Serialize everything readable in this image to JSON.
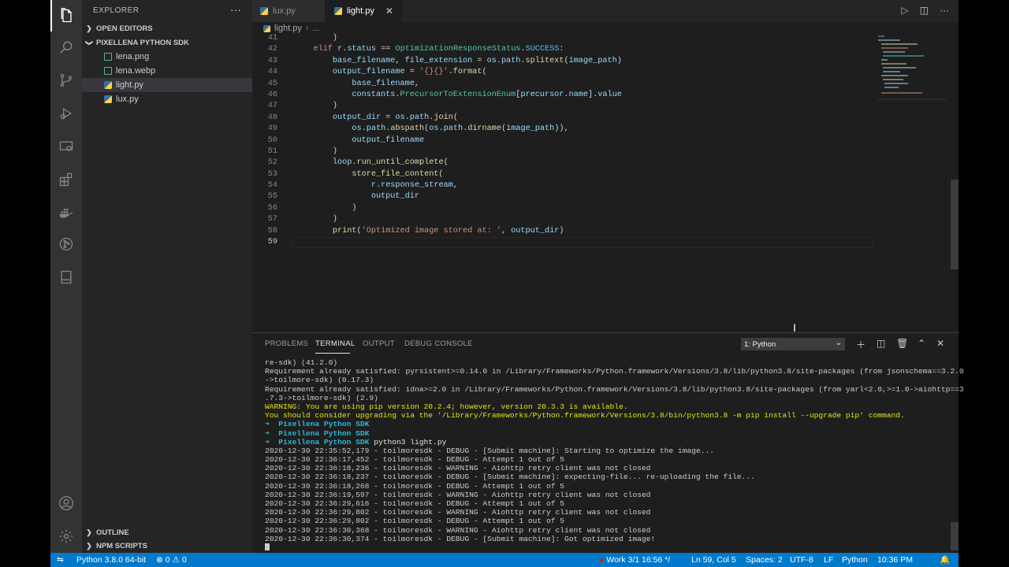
{
  "sidebar": {
    "title": "EXPLORER",
    "more": "···",
    "open_editors": "OPEN EDITORS",
    "folder": "PIXELLENA PYTHON SDK",
    "files": [
      {
        "name": "lena.png",
        "kind": "image"
      },
      {
        "name": "lena.webp",
        "kind": "image"
      },
      {
        "name": "light.py",
        "kind": "python"
      },
      {
        "name": "lux.py",
        "kind": "python"
      }
    ],
    "outline": "OUTLINE",
    "npm_scripts": "NPM SCRIPTS"
  },
  "editor": {
    "tabs": [
      {
        "label": "lux.py"
      },
      {
        "label": "light.py"
      }
    ],
    "breadcrumb": {
      "file": "light.py",
      "rest": "..."
    },
    "lines": [
      {
        "n": "41",
        "html": "        )"
      },
      {
        "n": "42",
        "html": "    <span class=\"kw\">elif</span> <span class=\"var\">r</span>.<span class=\"var\">status</span> == <span class=\"cls\">OptimizationResponseStatus</span>.<span class=\"cst\">SUCCESS</span>:"
      },
      {
        "n": "43",
        "html": "        <span class=\"var\">base_filename</span>, <span class=\"var\">file_extension</span> = <span class=\"var\">os</span>.<span class=\"var\">path</span>.<span class=\"fn\">splitext</span>(<span class=\"var\">image_path</span>)"
      },
      {
        "n": "44",
        "html": "        <span class=\"var\">output_filename</span> = <span class=\"str\">'{}{}'</span>.<span class=\"fn\">format</span>("
      },
      {
        "n": "45",
        "html": "            <span class=\"var\">base_filename</span>,"
      },
      {
        "n": "46",
        "html": "            <span class=\"var\">constants</span>.<span class=\"cls\">PrecursorToExtensionEnum</span>[<span class=\"var\">precursor</span>.<span class=\"var\">name</span>].<span class=\"var\">value</span>"
      },
      {
        "n": "47",
        "html": "        )"
      },
      {
        "n": "48",
        "html": "        <span class=\"var\">output_dir</span> = <span class=\"var\">os</span>.<span class=\"var\">path</span>.<span class=\"fn\">join</span>("
      },
      {
        "n": "49",
        "html": "            <span class=\"var\">os</span>.<span class=\"var\">path</span>.<span class=\"fn\">abspath</span>(<span class=\"var\">os</span>.<span class=\"var\">path</span>.<span class=\"fn\">dirname</span>(<span class=\"var\">image_path</span>)),"
      },
      {
        "n": "50",
        "html": "            <span class=\"var\">output_filename</span>"
      },
      {
        "n": "51",
        "html": "        )"
      },
      {
        "n": "52",
        "html": "        <span class=\"var\">loop</span>.<span class=\"fn\">run_until_complete</span>("
      },
      {
        "n": "53",
        "html": "            <span class=\"fn\">store_file_content</span>("
      },
      {
        "n": "54",
        "html": "                <span class=\"var\">r</span>.<span class=\"var\">response_stream</span>,"
      },
      {
        "n": "55",
        "html": "                <span class=\"var\">output_dir</span>"
      },
      {
        "n": "56",
        "html": "            )"
      },
      {
        "n": "57",
        "html": "        )"
      },
      {
        "n": "58",
        "html": "        <span class=\"fn\">print</span>(<span class=\"str\">'Optimized image stored at: '</span>, <span class=\"var\">output_dir</span>)"
      },
      {
        "n": "59",
        "html": ""
      }
    ]
  },
  "panel": {
    "tabs": [
      "PROBLEMS",
      "TERMINAL",
      "OUTPUT",
      "DEBUG CONSOLE"
    ],
    "terminal_select": "1: Python",
    "terminal_lines": [
      {
        "t": "re-sdk) (41.2.0)",
        "c": ""
      },
      {
        "t": "Requirement already satisfied: pyrsistent>=0.14.0 in /Library/Frameworks/Python.framework/Versions/3.8/lib/python3.8/site-packages (from jsonschema==3.2.0",
        "c": ""
      },
      {
        "t": "->toilmore-sdk) (0.17.3)",
        "c": ""
      },
      {
        "t": "Requirement already satisfied: idna>=2.0 in /Library/Frameworks/Python.framework/Versions/3.8/lib/python3.8/site-packages (from yarl<2.0,>=1.0->aiohttp==3",
        "c": ""
      },
      {
        "t": ".7.3->toilmore-sdk) (2.9)",
        "c": ""
      },
      {
        "t": "WARNING: You are using pip version 20.2.4; however, version 20.3.3 is available.",
        "c": "warn"
      },
      {
        "t": "You should consider upgrading via the '/Library/Frameworks/Python.framework/Versions/3.8/bin/python3.8 -m pip install --upgrade pip' command.",
        "c": "warn"
      },
      {
        "t": "Pixellena Python SDK",
        "c": "prompt",
        "cmd": ""
      },
      {
        "t": "Pixellena Python SDK",
        "c": "prompt",
        "cmd": ""
      },
      {
        "t": "Pixellena Python SDK",
        "c": "prompt",
        "cmd": "python3 light.py"
      },
      {
        "t": "2020-12-30 22:35:52,179 - toilmoresdk - DEBUG - [Submit machine]: Starting to optimize the image...",
        "c": ""
      },
      {
        "t": "2020-12-30 22:36:17,452 - toilmoresdk - DEBUG - Attempt 1 out of 5",
        "c": ""
      },
      {
        "t": "2020-12-30 22:36:18,236 - toilmoresdk - WARNING - Aiohttp retry client was not closed",
        "c": ""
      },
      {
        "t": "2020-12-30 22:36:18,237 - toilmoresdk - DEBUG - [Submit machine]: expecting-file... re-uploading the file...",
        "c": ""
      },
      {
        "t": "2020-12-30 22:36:18,268 - toilmoresdk - DEBUG - Attempt 1 out of 5",
        "c": ""
      },
      {
        "t": "2020-12-30 22:36:19,597 - toilmoresdk - WARNING - Aiohttp retry client was not closed",
        "c": ""
      },
      {
        "t": "2020-12-30 22:36:29,616 - toilmoresdk - DEBUG - Attempt 1 out of 5",
        "c": ""
      },
      {
        "t": "2020-12-30 22:36:29,802 - toilmoresdk - WARNING - Aiohttp retry client was not closed",
        "c": ""
      },
      {
        "t": "2020-12-30 22:36:29,802 - toilmoresdk - DEBUG - Attempt 1 out of 5",
        "c": ""
      },
      {
        "t": "2020-12-30 22:36:30,368 - toilmoresdk - WARNING - Aiohttp retry client was not closed",
        "c": ""
      },
      {
        "t": "2020-12-30 22:36:30,374 - toilmoresdk - DEBUG - [Submit machine]: Got optimized image!",
        "c": ""
      }
    ],
    "prompt_arrow": "➜"
  },
  "statusbar": {
    "interpreter": "Python 3.8.0 64-bit",
    "errors": "0",
    "warnings": "0",
    "work": "Work",
    "work_time": "3/1 16:56 */",
    "position": "Ln 59, Col 5",
    "spaces": "Spaces: 2",
    "encoding": "UTF-8",
    "eol": "LF",
    "language": "Python",
    "clock": "10:36 PM"
  },
  "colors": {
    "accent": "#007acc",
    "activity_bar": "#333333",
    "sidebar": "#252526",
    "editor": "#1e1e1e"
  }
}
